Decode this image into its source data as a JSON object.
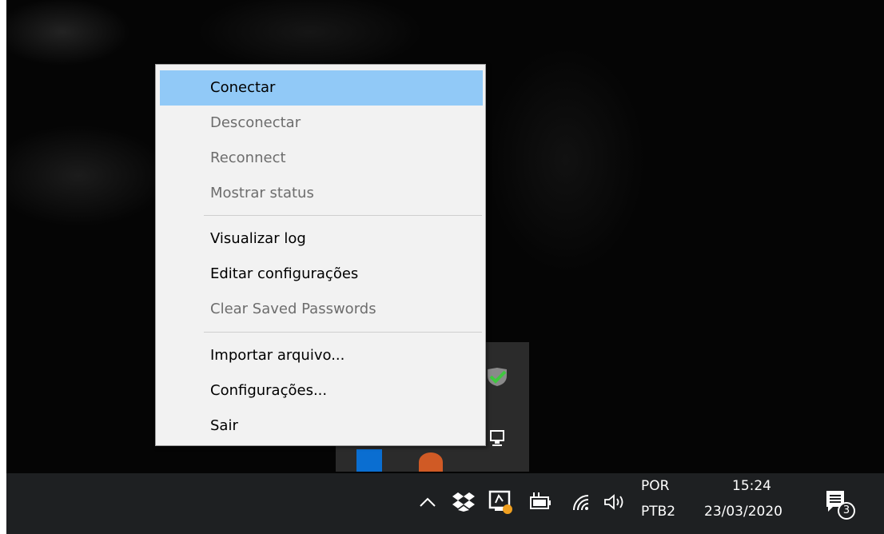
{
  "menu": {
    "items": [
      {
        "label": "Conectar",
        "enabled": true,
        "highlighted": true
      },
      {
        "label": "Desconectar",
        "enabled": false
      },
      {
        "label": "Reconnect",
        "enabled": false
      },
      {
        "label": "Mostrar status",
        "enabled": false
      },
      {
        "label": "Visualizar log",
        "enabled": true
      },
      {
        "label": "Editar configurações",
        "enabled": true
      },
      {
        "label": "Clear Saved Passwords",
        "enabled": false
      },
      {
        "label": "Importar arquivo...",
        "enabled": true
      },
      {
        "label": "Configurações...",
        "enabled": true
      },
      {
        "label": "Sair",
        "enabled": true
      }
    ]
  },
  "taskbar": {
    "language": "POR",
    "keyboard_layout": "PTB2",
    "time": "15:24",
    "date": "23/03/2020",
    "notification_count": "3",
    "icons": [
      "chevron-up-icon",
      "dropbox-icon",
      "openvpn-icon",
      "battery-icon",
      "wifi-icon",
      "volume-icon",
      "action-center-icon"
    ]
  },
  "colors": {
    "highlight": "#91c9f7",
    "menu_bg": "#f2f2f2",
    "disabled_text": "#6d6d6d",
    "taskbar_bg": "#1e2022"
  }
}
